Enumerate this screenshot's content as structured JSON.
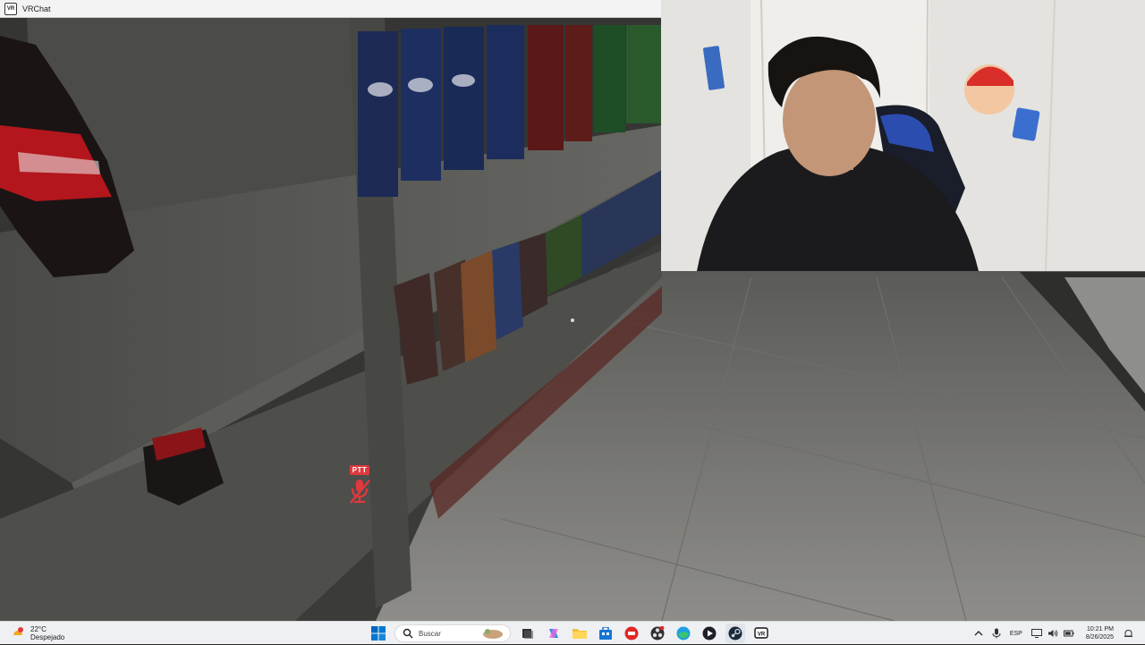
{
  "window": {
    "title": "VRChat",
    "app_icon": "vrchat-icon"
  },
  "hud": {
    "ptt_label": "PTT",
    "mic_state": "muted",
    "mic_color": "#e0393e"
  },
  "taskbar": {
    "weather": {
      "badge": "3",
      "temp": "22°C",
      "condition": "Despejado"
    },
    "search_placeholder": "Buscar",
    "apps": [
      "start-icon",
      "search-icon",
      "widget-icon",
      "task-view-icon",
      "copilot-icon",
      "file-explorer-icon",
      "store-icon",
      "red-app-icon",
      "obs-icon",
      "edge-icon",
      "media-player-icon",
      "steam-icon",
      "vrchat-icon"
    ],
    "tray": {
      "language": "ESP",
      "time": "10:21 PM",
      "date": "8/26/2025"
    }
  },
  "colors": {
    "accent": "#0067c0",
    "taskbar_bg": "#eef0f3"
  }
}
